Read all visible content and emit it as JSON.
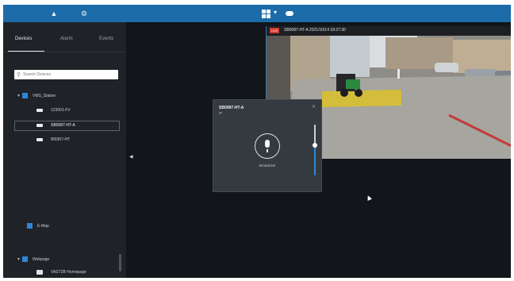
{
  "top_bar": {
    "icons": [
      "home-icon",
      "gear-icon",
      "layout-grid-icon",
      "chevron-down-icon",
      "cloud-icon"
    ]
  },
  "sidebar": {
    "tabs": [
      {
        "label": "Devices",
        "active": true
      },
      {
        "label": "Alarm",
        "active": false
      },
      {
        "label": "Events",
        "active": false
      }
    ],
    "search": {
      "placeholder": "Search Devices",
      "value": ""
    },
    "tree": {
      "group": "VMS_Station",
      "devices": [
        {
          "name": "123001-FV",
          "icon": "camera-icon"
        },
        {
          "name": "SB0087-HT-A",
          "icon": "ptz-camera-icon",
          "selected": true
        },
        {
          "name": "IB9367-HT",
          "icon": "bullet-camera-icon"
        }
      ],
      "extra_group": "E-Map",
      "webpage_group": "Webpage",
      "webpage_item": "VAST2B Homepage"
    }
  },
  "video": {
    "badge": "LIVE",
    "title": "SB0087-HT-A   2021/10/14 18:27:30"
  },
  "talk_popup": {
    "device_name": "SB0087-HT-A",
    "device_sub": "IP",
    "mic_label": "Broadcast",
    "volume_level": 0.6
  }
}
